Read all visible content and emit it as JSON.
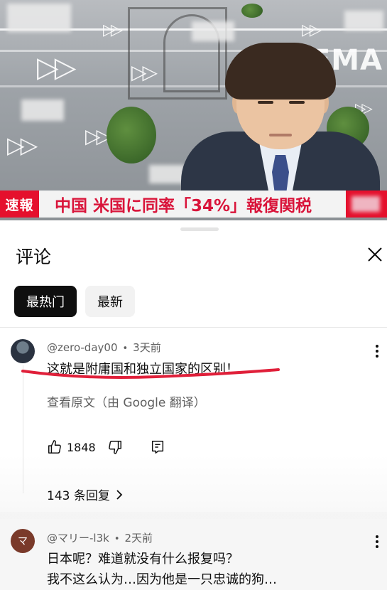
{
  "video": {
    "banner_tag": "速報",
    "banner_headline": "中国 米国に同率「34%」報復関税",
    "brand_text": "DEMA"
  },
  "sheet": {
    "title": "评论",
    "close_icon": "close-icon",
    "chips": [
      {
        "label": "最热门",
        "active": true
      },
      {
        "label": "最新",
        "active": false
      }
    ]
  },
  "comments": [
    {
      "author": "@zero-day00",
      "separator": "•",
      "time": "3天前",
      "text": "这就是附庸国和独立国家的区别！",
      "translate_label": "查看原文（由 Google 翻译）",
      "like_count": "1848",
      "replies_label": "143 条回复",
      "underline_color": "#e0203a"
    },
    {
      "author": "@マリー-l3k",
      "separator": "•",
      "time": "2天前",
      "avatar_letter": "マ",
      "text_line1": "日本呢？难道就没有什么报复吗？",
      "text_line2": "我不这么认为…因为他是一只忠诚的狗…"
    }
  ],
  "icons": {
    "like": "thumbs-up-icon",
    "dislike": "thumbs-down-icon",
    "reply": "reply-icon",
    "more": "more-vert-icon",
    "chevron": "chevron-right-icon"
  }
}
